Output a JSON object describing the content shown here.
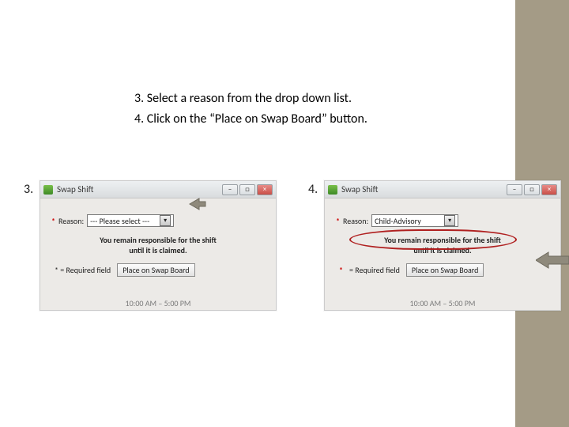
{
  "instructions": {
    "line3": "3. Select a reason from the drop down list.",
    "line4": "4. Click on the “Place on Swap Board” button."
  },
  "step_labels": {
    "s3": "3.",
    "s4": "4."
  },
  "dialog": {
    "title": "Swap Shift",
    "reason_label": "Reason:",
    "required_star": "*",
    "required_text": "* = Required field",
    "notice_line1": "You remain responsible for the shift",
    "notice_line2": "until it is claimed.",
    "place_button": "Place on Swap Board"
  },
  "shot3": {
    "reason_value": "--- Please select ---",
    "time_range": "10:00 AM – 5:00 PM"
  },
  "shot4": {
    "reason_value": "Child-Advisory",
    "time_range": "10:00 AM – 5:00 PM"
  },
  "winbtns": {
    "min": "–",
    "max": "□",
    "close": "×"
  }
}
